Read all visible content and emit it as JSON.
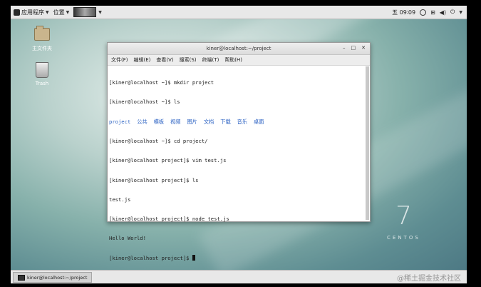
{
  "top_panel": {
    "apps_menu": "应用程序",
    "places_menu": "位置",
    "task_thumb_label": " ",
    "clock": "五 09∶09"
  },
  "desktop": {
    "icons": [
      {
        "label": "主文件夹"
      },
      {
        "label": "Trash"
      }
    ],
    "branding_number": "7",
    "branding_word": "CENTOS"
  },
  "terminal": {
    "title": "kiner@localhost:~/project",
    "window_buttons": {
      "minimize": "–",
      "maximize": "□",
      "close": "✕"
    },
    "menu": [
      "文件(F)",
      "编辑(E)",
      "查看(V)",
      "搜索(S)",
      "终端(T)",
      "帮助(H)"
    ],
    "lines": [
      "[kiner@localhost ~]$ mkdir project",
      "[kiner@localhost ~]$ ls"
    ],
    "dir_listing": [
      "project",
      "公共",
      "模板",
      "视频",
      "图片",
      "文档",
      "下载",
      "音乐",
      "桌面"
    ],
    "lines2": [
      "[kiner@localhost ~]$ cd project/",
      "[kiner@localhost project]$ vim test.js",
      "[kiner@localhost project]$ ls",
      "test.js",
      "[kiner@localhost project]$ node test.js",
      "Hello World!"
    ],
    "prompt": "[kiner@localhost project]$ "
  },
  "bottom_panel": {
    "task_label": "kiner@localhost:~/project",
    "watermark": "@稀土掘金技术社区"
  },
  "colors": {
    "dir_blue": "#2b62c3",
    "panel_bg": "#e8e8e8"
  }
}
